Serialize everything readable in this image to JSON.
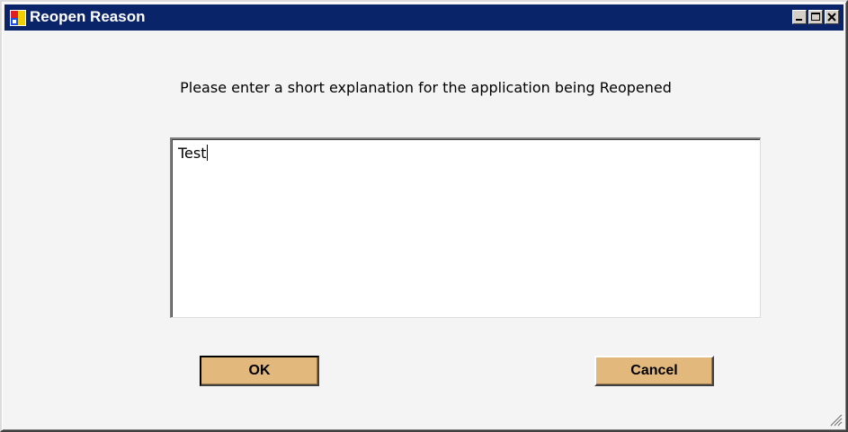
{
  "window": {
    "title": "Reopen Reason"
  },
  "icons": {
    "app": "app-icon",
    "minimize": "minimize-icon",
    "maximize": "maximize-icon",
    "close": "close-icon",
    "resize": "resize-grip-icon"
  },
  "dialog": {
    "prompt": "Please enter a short explanation for the application being Reopened",
    "reason_value": "Test",
    "ok_label": "OK",
    "cancel_label": "Cancel"
  },
  "colors": {
    "titlebar": "#0a246a",
    "button_face": "#e2b87d",
    "window_bg": "#f4f4f4"
  }
}
